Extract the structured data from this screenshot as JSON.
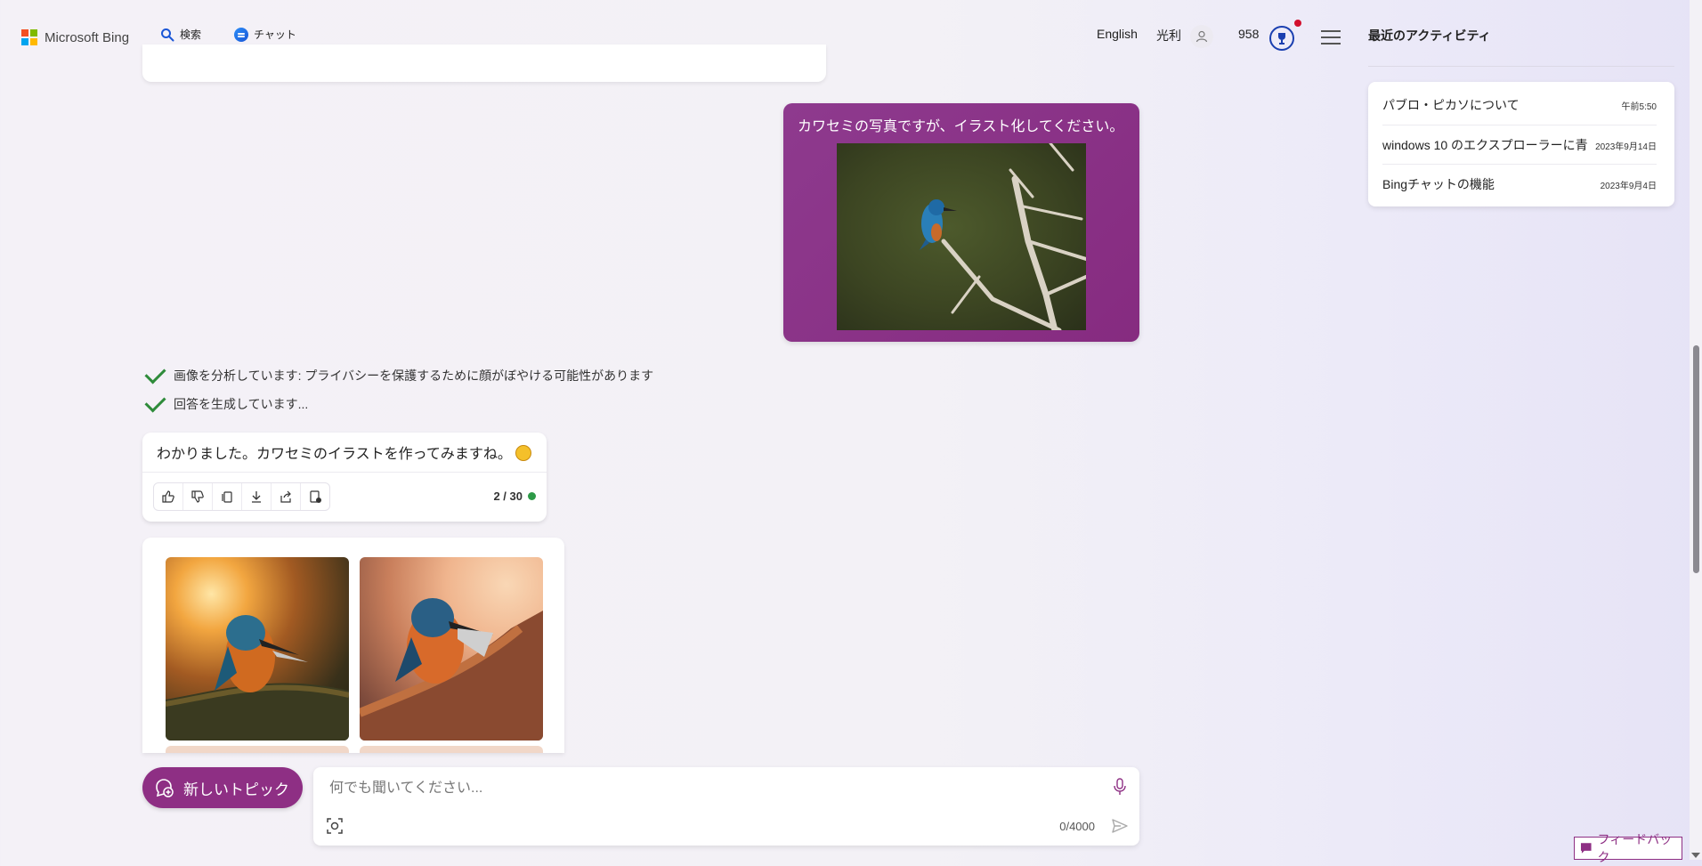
{
  "header": {
    "brand": "Microsoft Bing",
    "tabs": [
      {
        "label": "検索",
        "icon": "search-icon"
      },
      {
        "label": "チャット",
        "icon": "chat-icon",
        "active": true
      }
    ],
    "language": "English",
    "user_name": "光利",
    "reward_points": "958",
    "colors": {
      "accent_blue": "#174ae4",
      "brand_purple": "#8e2f84"
    }
  },
  "chat": {
    "user_message": "カワセミの写真ですが、イラスト化してください。",
    "status_lines": [
      "画像を分析しています: プライバシーを保護するために顔がぼやける可能性があります",
      "回答を生成しています..."
    ],
    "bot_message": "わかりました。カワセミのイラストを作ってみますね。",
    "bot_actions": [
      "like-icon",
      "dislike-icon",
      "copy-icon",
      "download-icon",
      "share-icon",
      "export-icon"
    ],
    "turn_counter": "2 / 30"
  },
  "composer": {
    "new_topic_label": "新しいトピック",
    "placeholder": "何でも聞いてください...",
    "char_count": "0/4000"
  },
  "sidebar": {
    "title": "最近のアクティビティ",
    "items": [
      {
        "title": "パブロ・ピカソについて",
        "date": "午前5:50"
      },
      {
        "title": "windows 10 のエクスプローラーに青",
        "date": "2023年9月14日"
      },
      {
        "title": "Bingチャットの機能",
        "date": "2023年9月4日"
      }
    ]
  },
  "feedback_label": "フィードバック"
}
